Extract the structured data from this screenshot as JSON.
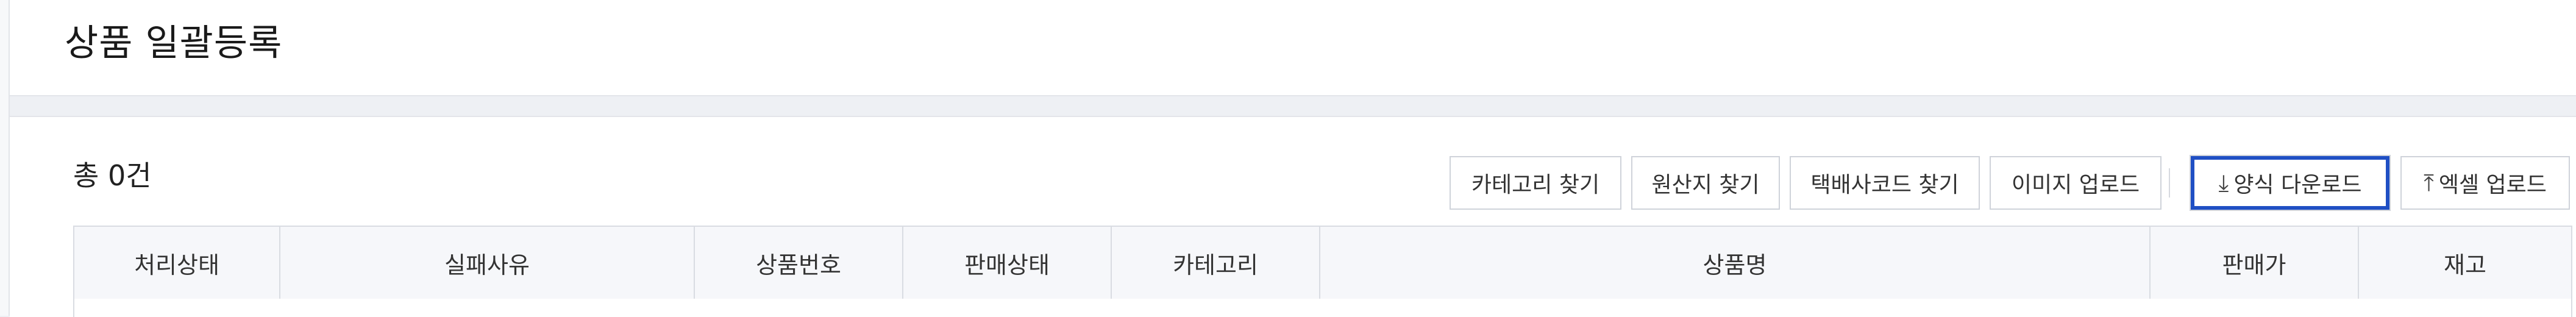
{
  "header": {
    "title": "상품 일괄등록"
  },
  "summary": {
    "total_text": "총 0건"
  },
  "toolbar": {
    "find_category": "카테고리 찾기",
    "find_origin": "원산지 찾기",
    "find_courier_code": "택배사코드 찾기",
    "image_upload": "이미지 업로드",
    "download_template": "양식 다운로드",
    "excel_upload": "엑셀 업로드",
    "download_icon": "download-icon",
    "upload_icon": "upload-icon"
  },
  "table": {
    "columns": [
      "처리상태",
      "실패사유",
      "상품번호",
      "판매상태",
      "카테고리",
      "상품명",
      "판매가",
      "재고"
    ],
    "rows": []
  },
  "colors": {
    "accent": "#1f4fc4",
    "background": "#eef0f4",
    "header_bg": "#f6f7fa"
  }
}
